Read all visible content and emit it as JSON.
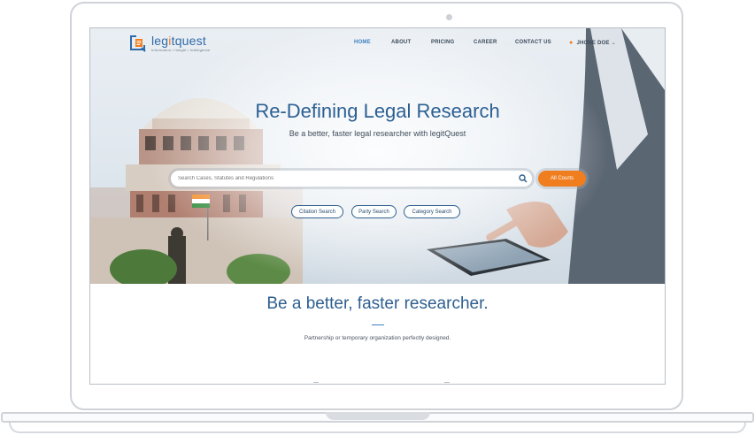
{
  "brand": {
    "name_prefix": "leg",
    "name_highlight": "i",
    "name_suffix": "tquest",
    "tagline": "Information • Insight • Intelligence"
  },
  "nav": {
    "items": [
      {
        "label": "HOME",
        "active": true
      },
      {
        "label": "ABOUT",
        "active": false
      },
      {
        "label": "PRICING",
        "active": false
      },
      {
        "label": "CAREER",
        "active": false
      },
      {
        "label": "CONTACT US",
        "active": false
      }
    ],
    "user_label": "JHONE DOE"
  },
  "hero": {
    "title": "Re-Defining Legal Research",
    "subtitle": "Be a better, faster legal researcher with legitQuest"
  },
  "search": {
    "placeholder": "Search Cases, Statutes and Regulations",
    "scope_button": "All Courts"
  },
  "quick_search": {
    "citation": "Citation Search",
    "party": "Party Search",
    "category": "Category Search"
  },
  "section": {
    "title": "Be a better, faster researcher.",
    "text": "Partnership or temporary organization perfectly designed."
  },
  "colors": {
    "accent": "#f07d1e",
    "primary": "#2f6aa8",
    "active_nav": "#3b7fc1"
  },
  "icons": [
    "camera-icon",
    "logo-icon",
    "user-icon",
    "chevron-down-icon",
    "search-icon"
  ]
}
